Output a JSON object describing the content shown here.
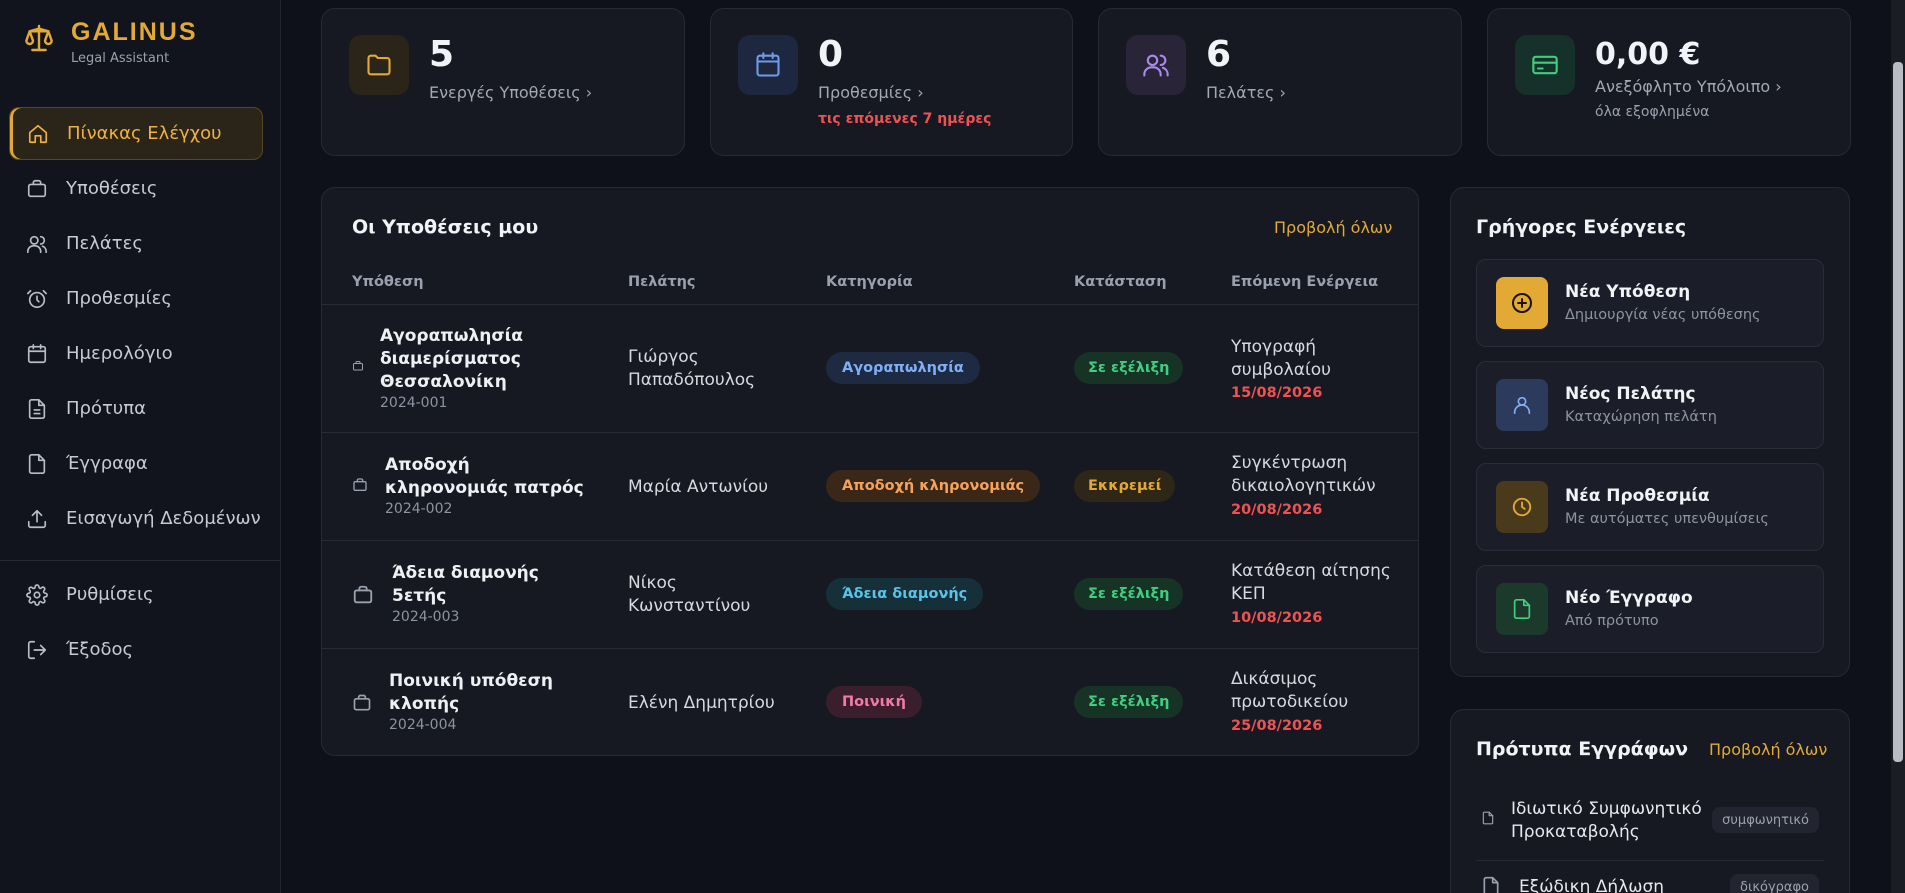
{
  "brand": {
    "name": "GALINUS",
    "subtitle": "Legal Assistant"
  },
  "sidebar": {
    "items": [
      {
        "label": "Πίνακας Ελέγχου",
        "icon": "home-icon",
        "active": true
      },
      {
        "label": "Υποθέσεις",
        "icon": "briefcase-icon"
      },
      {
        "label": "Πελάτες",
        "icon": "users-icon"
      },
      {
        "label": "Προθεσμίες",
        "icon": "alarm-clock-icon"
      },
      {
        "label": "Ημερολόγιο",
        "icon": "calendar-icon"
      },
      {
        "label": "Πρότυπα",
        "icon": "file-text-icon"
      },
      {
        "label": "Έγγραφα",
        "icon": "file-icon"
      },
      {
        "label": "Εισαγωγή Δεδομένων",
        "icon": "upload-icon"
      }
    ],
    "bottom_items": [
      {
        "label": "Ρυθμίσεις",
        "icon": "gear-icon"
      },
      {
        "label": "Έξοδος",
        "icon": "logout-icon"
      }
    ]
  },
  "stats": [
    {
      "value": "5",
      "label": "Ενεργές Υποθέσεις ›",
      "extra": "",
      "icon": "folder-icon",
      "color": "#e3a935"
    },
    {
      "value": "0",
      "label": "Προθεσμίες ›",
      "extra": "τις επόμενες 7 ημέρες",
      "icon": "calendar-icon",
      "color": "#6f9be8"
    },
    {
      "value": "6",
      "label": "Πελάτες ›",
      "extra": "",
      "icon": "users-icon",
      "color": "#a88bea"
    },
    {
      "value": "0,00 €",
      "label": "Ανεξόφλητο Υπόλοιπο ›",
      "extra": "όλα εξοφλημένα",
      "icon": "credit-card-icon",
      "color": "#3fcf7f"
    }
  ],
  "cases": {
    "title": "Οι Υποθέσεις μου",
    "view_all": "Προβολή όλων",
    "columns": [
      "Υπόθεση",
      "Πελάτης",
      "Κατηγορία",
      "Κατάσταση",
      "Επόμενη Ενέργεια"
    ],
    "rows": [
      {
        "title": [
          "Αγοραπωλησία",
          "διαμερίσματος",
          "Θεσσαλονίκη"
        ],
        "number": "2024-001",
        "client": [
          "Γιώργος",
          "Παπαδόπουλος"
        ],
        "category": "Αγοραπωλησία",
        "status": "Σε εξέλιξη",
        "next": [
          "Υπογραφή",
          "συμβολαίου"
        ],
        "date": "15/08/2026"
      },
      {
        "title": [
          "Αποδοχή",
          "κληρονομιάς πατρός"
        ],
        "number": "2024-002",
        "client": [
          "Μαρία Αντωνίου"
        ],
        "category": "Αποδοχή κληρονομιάς",
        "status": "Εκκρεμεί",
        "next": [
          "Συγκέντρωση",
          "δικαιολογητικών"
        ],
        "date": "20/08/2026"
      },
      {
        "title": [
          "Άδεια διαμονής",
          "5ετής"
        ],
        "number": "2024-003",
        "client": [
          "Νίκος",
          "Κωνσταντίνου"
        ],
        "category": "Άδεια διαμονής",
        "status": "Σε εξέλιξη",
        "next": [
          "Κατάθεση αίτησης",
          "ΚΕΠ"
        ],
        "date": "10/08/2026"
      },
      {
        "title": [
          "Ποινική υπόθεση",
          "κλοπής"
        ],
        "number": "2024-004",
        "client": [
          "Ελένη Δημητρίου"
        ],
        "category": "Ποινική",
        "status": "Σε εξέλιξη",
        "next": [
          "Δικάσιμος",
          "πρωτοδικείου"
        ],
        "date": "25/08/2026"
      }
    ]
  },
  "quick_actions": {
    "title": "Γρήγορες Ενέργειες",
    "items": [
      {
        "title": "Νέα Υπόθεση",
        "subtitle": "Δημιουργία νέας υπόθεσης",
        "icon": "plus-circle-icon"
      },
      {
        "title": "Νέος Πελάτης",
        "subtitle": "Καταχώρηση πελάτη",
        "icon": "user-icon"
      },
      {
        "title": "Νέα Προθεσμία",
        "subtitle": "Με αυτόματες υπενθυμίσεις",
        "icon": "clock-icon"
      },
      {
        "title": "Νέο Έγγραφο",
        "subtitle": "Από πρότυπο",
        "icon": "file-icon"
      }
    ]
  },
  "templates": {
    "title": "Πρότυπα Εγγράφων",
    "view_all": "Προβολή όλων",
    "items": [
      {
        "name": [
          "Ιδιωτικό Συμφωνητικό",
          "Προκαταβολής"
        ],
        "tag": "συμφωνητικό"
      },
      {
        "name": [
          "Εξώδικη Δήλωση"
        ],
        "tag": "δικόγραφο"
      }
    ]
  },
  "colors": {
    "accent": "#e3a935",
    "danger": "#f05252",
    "success": "#3fcf7f",
    "background": "#0f111a",
    "card": "#161922"
  }
}
